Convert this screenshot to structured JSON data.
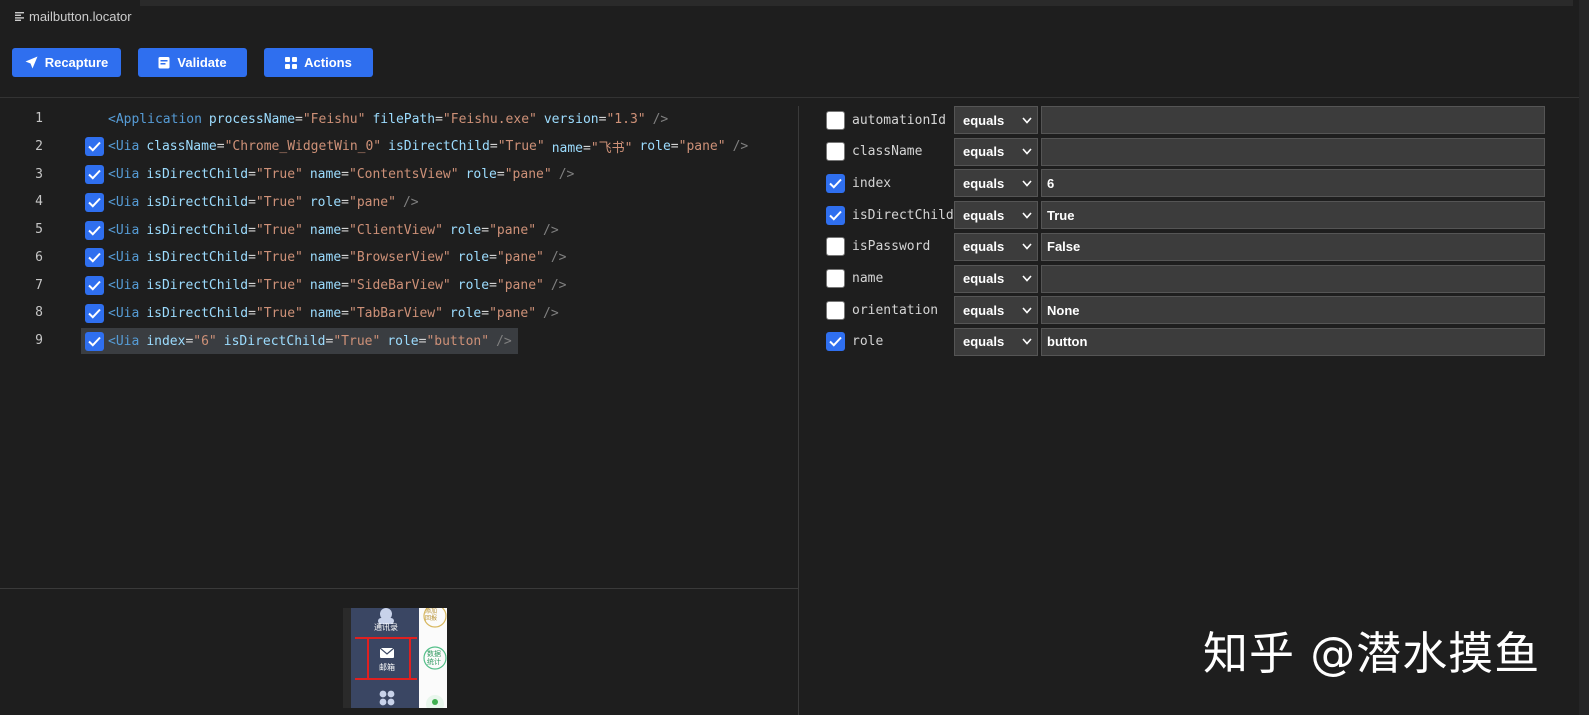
{
  "file": {
    "name": "mailbutton.locator",
    "icon": "list-icon"
  },
  "toolbar": {
    "recapture": {
      "label": "Recapture",
      "icon": "send-arrow-icon"
    },
    "validate": {
      "label": "Validate",
      "icon": "clipboard-icon"
    },
    "actions": {
      "label": "Actions",
      "icon": "grid-icon"
    }
  },
  "code_lines": [
    {
      "num": "1",
      "checked": null,
      "tag": "<Application",
      "attrs": [
        [
          "processName",
          "\"Feishu\""
        ],
        [
          "filePath",
          "\"Feishu.exe\""
        ],
        [
          "version",
          "\"1.3\""
        ]
      ],
      "close": "/>"
    },
    {
      "num": "2",
      "checked": true,
      "tag": "<Uia",
      "attrs": [
        [
          "className",
          "\"Chrome_WidgetWin_0\""
        ],
        [
          "isDirectChild",
          "\"True\""
        ],
        [
          "name",
          "\"飞书\""
        ],
        [
          "role",
          "\"pane\""
        ]
      ],
      "close": "/>"
    },
    {
      "num": "3",
      "checked": true,
      "tag": "<Uia",
      "attrs": [
        [
          "isDirectChild",
          "\"True\""
        ],
        [
          "name",
          "\"ContentsView\""
        ],
        [
          "role",
          "\"pane\""
        ]
      ],
      "close": "/>"
    },
    {
      "num": "4",
      "checked": true,
      "tag": "<Uia",
      "attrs": [
        [
          "isDirectChild",
          "\"True\""
        ],
        [
          "role",
          "\"pane\""
        ]
      ],
      "close": "/>"
    },
    {
      "num": "5",
      "checked": true,
      "tag": "<Uia",
      "attrs": [
        [
          "isDirectChild",
          "\"True\""
        ],
        [
          "name",
          "\"ClientView\""
        ],
        [
          "role",
          "\"pane\""
        ]
      ],
      "close": "/>"
    },
    {
      "num": "6",
      "checked": true,
      "tag": "<Uia",
      "attrs": [
        [
          "isDirectChild",
          "\"True\""
        ],
        [
          "name",
          "\"BrowserView\""
        ],
        [
          "role",
          "\"pane\""
        ]
      ],
      "close": "/>"
    },
    {
      "num": "7",
      "checked": true,
      "tag": "<Uia",
      "attrs": [
        [
          "isDirectChild",
          "\"True\""
        ],
        [
          "name",
          "\"SideBarView\""
        ],
        [
          "role",
          "\"pane\""
        ]
      ],
      "close": "/>"
    },
    {
      "num": "8",
      "checked": true,
      "tag": "<Uia",
      "attrs": [
        [
          "isDirectChild",
          "\"True\""
        ],
        [
          "name",
          "\"TabBarView\""
        ],
        [
          "role",
          "\"pane\""
        ]
      ],
      "close": "/>"
    },
    {
      "num": "9",
      "checked": true,
      "tag": "<Uia",
      "attrs": [
        [
          "index",
          "\"6\""
        ],
        [
          "isDirectChild",
          "\"True\""
        ],
        [
          "role",
          "\"button\""
        ]
      ],
      "close": "/>",
      "selected": true
    }
  ],
  "properties": [
    {
      "name": "automationId",
      "checked": false,
      "operator": "equals",
      "value": ""
    },
    {
      "name": "className",
      "checked": false,
      "operator": "equals",
      "value": ""
    },
    {
      "name": "index",
      "checked": true,
      "operator": "equals",
      "value": "6"
    },
    {
      "name": "isDirectChild",
      "checked": true,
      "operator": "equals",
      "value": "True"
    },
    {
      "name": "isPassword",
      "checked": false,
      "operator": "equals",
      "value": "False"
    },
    {
      "name": "name",
      "checked": false,
      "operator": "equals",
      "value": ""
    },
    {
      "name": "orientation",
      "checked": false,
      "operator": "equals",
      "value": "None"
    },
    {
      "name": "role",
      "checked": true,
      "operator": "equals",
      "value": "button"
    }
  ],
  "preview": {
    "labels": {
      "contacts": "通讯录",
      "mail": "邮箱",
      "side_top": "添加\n回报",
      "side_mid": "数据\n统计"
    }
  },
  "watermark": "知乎 @潜水摸鱼",
  "colors": {
    "accent": "#2f6fef",
    "background": "#1e1e1e",
    "field": "#3c3c3c"
  }
}
